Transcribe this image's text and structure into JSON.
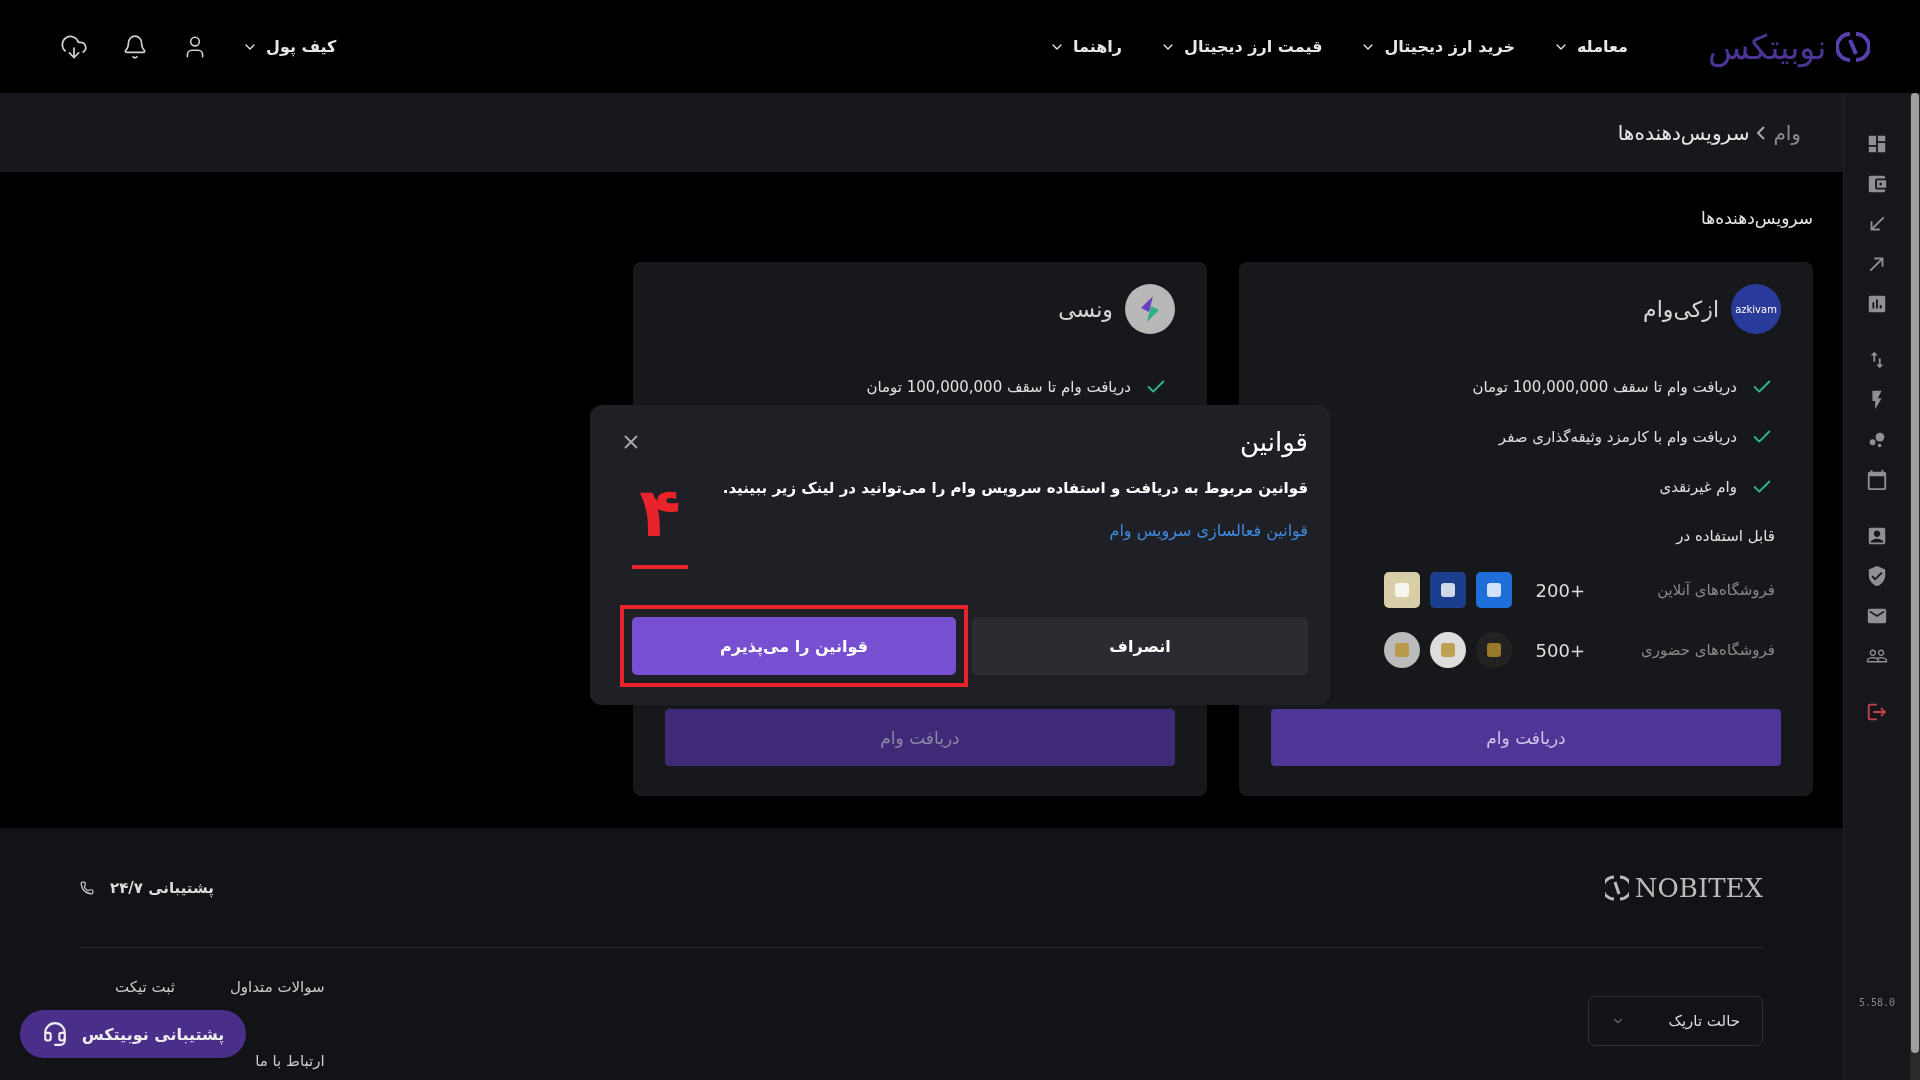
{
  "header": {
    "logo": "نوبیتکس",
    "nav": [
      {
        "label": "معامله"
      },
      {
        "label": "خرید ارز دیجیتال"
      },
      {
        "label": "قیمت ارز دیجیتال"
      },
      {
        "label": "راهنما"
      }
    ],
    "wallet": "کیف پول"
  },
  "breadcrumb": [
    "وام",
    "سرویس‌دهنده‌ها"
  ],
  "page_title": "سرویس‌دهنده‌ها",
  "providers": [
    {
      "name": "ازکی‌وام",
      "logo_text": "azkivam",
      "features": [
        "دریافت وام تا سقف 100,000,000 تومان",
        "دریافت وام با کارمزد وثیقه‌گذاری صفر",
        "وام غیرنقدی"
      ],
      "usable_in": "قابل استفاده در",
      "stores": [
        {
          "label": "فروشگاه‌های آنلاین",
          "count": "+200"
        },
        {
          "label": "فروشگاه‌های حضوری",
          "count": "+500"
        }
      ],
      "button": "دریافت وام",
      "button_disabled": false
    },
    {
      "name": "ونسی",
      "features": [
        "دریافت وام تا سقف 100,000,000 تومان"
      ],
      "button": "دریافت وام",
      "button_disabled": true
    }
  ],
  "modal": {
    "title": "قوانین",
    "text": "قوانین مربوط به دریافت و استفاده سرویس وام را می‌توانید در لینک زیر ببینید.",
    "link": "قوانین فعالسازی سرویس وام",
    "cancel": "انصراف",
    "accept": {
      "label": "قوانین را می‌پذیرم",
      "highlighted": true
    },
    "annotation": "۴"
  },
  "footer": {
    "logo": "NOBITEX",
    "support": "پشتیبانی ۲۴/۷",
    "link_columns": [
      [
        "سوالات متداول",
        "ارتباط با ما"
      ],
      [
        "ثبت تیکت"
      ]
    ],
    "theme_select": "حالت تاریک",
    "support_button": "پشتیبانی نوبیتکس"
  },
  "version": "5.58.0"
}
